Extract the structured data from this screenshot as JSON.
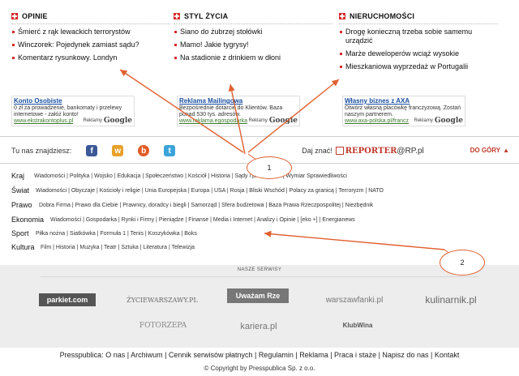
{
  "columns": [
    {
      "title": "OPINIE",
      "items": [
        "Śmierć z rąk lewackich terrorystów",
        "Winczorek: Pojedynek zamiast sądu?",
        "Komentarz rysunkowy. Londyn"
      ]
    },
    {
      "title": "STYL ŻYCIA",
      "items": [
        "Siano do żubrzej stołówki",
        "Mamo! Jakie tygrysy!",
        "Na stadionie z drinkiem w dłoni"
      ]
    },
    {
      "title": "NIERUCHOMOŚCI",
      "items": [
        "Drogę konieczną trzeba sobie samemu urządzić",
        "Marże deweloperów wciąż wysokie",
        "Mieszkaniowa wyprzedaż w Portugalii"
      ]
    }
  ],
  "ads": [
    {
      "title": "Konto Osobiste",
      "body": "0 zł za prowadzenie, bankomaty i przelewy internetowe - załóż konto!",
      "url": "www.ekstrakontoplus.pl",
      "badge": "Reklamy",
      "brand": "Google"
    },
    {
      "title": "Reklama Mailingowa",
      "body": "Bezpośrednie dotarcie do Klientów. Baza ponad 530 tys. adresów.",
      "url": "www.reklama.egospodarka",
      "badge": "Reklamy",
      "brand": "Google"
    },
    {
      "title": "Własny biznes z AXA",
      "body": "Otwórz własną placówkę franczyzową. Zostań naszym partnerem.",
      "url": "www.axa-polska.pl/francz",
      "badge": "Reklamy",
      "brand": "Google"
    }
  ],
  "social": {
    "label": "Tu nas znajdziesz:",
    "icons": [
      "f",
      "w",
      "b",
      "t"
    ],
    "icon_names": [
      "facebook-icon",
      "wykop-icon",
      "blip-icon",
      "twitter-icon"
    ],
    "icon_colors": [
      "#3b5998",
      "#e8a02a",
      "#e25b24",
      "#3ca3d9"
    ]
  },
  "daj_znac": {
    "label": "Daj znać!",
    "logo_prefix": "REPORTER",
    "logo_suffix": "@RP.pl"
  },
  "do_gory": "DO GÓRY",
  "categories": [
    {
      "name": "Kraj",
      "links": "Wiadomości | Polityka | Wojsko | Edukacja | Społeczeństwo | Kościół | Historia | Sądy i prokuratura | Wymiar Sprawiedliwości"
    },
    {
      "name": "Świat",
      "links": "Wiadomości | Obyczaje | Kościoły i religie | Unia Europejska | Europa | USA | Rosja | Bliski Wschód | Polacy za granicą | Terroryzm | NATO"
    },
    {
      "name": "Prawo",
      "links": "Dobra Firma | Prawo dla Ciebie | Prawnicy, doradcy i biegli | Samorząd | Sfera budżetowa | Baza Prawa Rzeczpospolitej | Niezbędnik"
    },
    {
      "name": "Ekonomia",
      "links": "Wiadomości | Gospodarka | Rynki i Firmy | Pieniądze | Finanse | Media i Internet | Analizy i Opinie | [eko +] | Energianews"
    },
    {
      "name": "Sport",
      "links": "Piłka nożna | Siatkówka | Formuła 1 | Tenis | Koszykówka | Boks"
    },
    {
      "name": "Kultura",
      "links": "Film | Historia | Muzyka | Teatr | Sztuka | Literatura | Telewizja"
    }
  ],
  "nasze_serwisy": "NASZE SERWISY",
  "services_row1": [
    "parkiet.com",
    "ŻYCIEWARSZAWY.PL",
    "Uważam Rze",
    "warszawfanki.pl",
    "kulinarnik.pl"
  ],
  "services_row2": [
    "FOTORZEPA",
    "kariera.pl",
    "KlubWina"
  ],
  "footer": {
    "brand": "Presspublica:",
    "links": [
      "O nas",
      "Archiwum",
      "Cennik serwisów płatnych",
      "Regulamin",
      "Reklama",
      "Praca i staże",
      "Napisz do nas",
      "Kontakt"
    ]
  },
  "copyright": "© Copyright by Presspublica Sp. z o.o.",
  "callouts": [
    "1",
    "2"
  ],
  "colors": {
    "accent": "#d42b2b",
    "link": "#1a4fa1",
    "callout": "#e0602f"
  }
}
